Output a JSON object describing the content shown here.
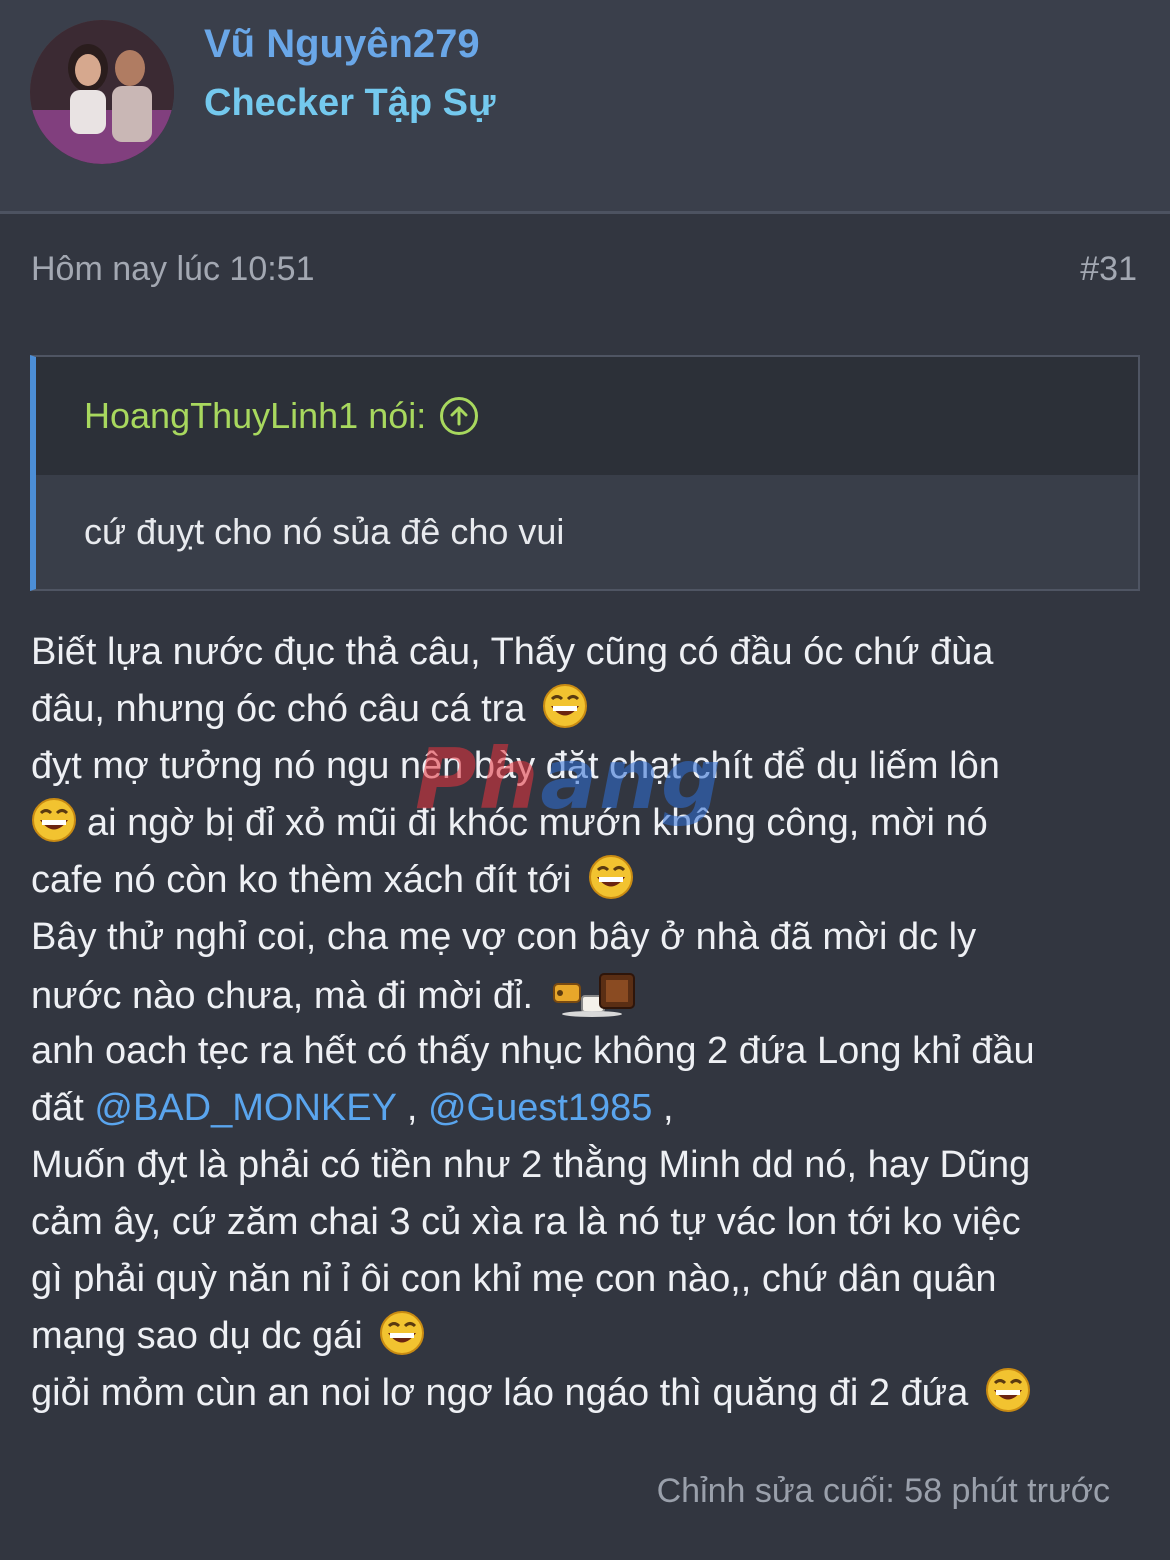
{
  "user": {
    "name": "Vũ Nguyên279",
    "title": "Checker Tập Sự"
  },
  "post": {
    "time": "Hôm nay lúc 10:51",
    "number": "#31",
    "edited": "Chỉnh sửa cuối: 58 phút trước"
  },
  "quote": {
    "author": "HoangThuyLinh1 nói:",
    "arrow_icon": "arrow-up-circle-icon",
    "text": "cứ đuỵt cho nó sủa đê cho vui"
  },
  "body": {
    "l1": "Biết lựa nước đục thả câu, Thấy cũng có đầu óc chứ đùa",
    "l2": "đâu, nhưng óc chó câu cá tra",
    "l3": "đỵt mợ tưởng nó ngu nên bày đặt chạt chít để dụ liếm lôn",
    "l4": "ai ngờ bị đỉ xỏ mũi đi khóc mướn không công, mời nó",
    "l5": "cafe nó còn ko thèm xách đít tới",
    "l6": "Bây thử nghỉ coi, cha mẹ vợ con bây ở nhà đã mời dc ly",
    "l7": "nước nào chưa, mà đi mời đỉ.",
    "l8": "anh oach tẹc ra hết có thấy nhục không 2 đứa Long khỉ đầu",
    "l9_prefix": "đất",
    "mention1": "@BAD_MONKEY",
    "sep1": ",",
    "mention2": "@Guest1985",
    "sep2": ",",
    "l10": "Muốn đỵt là phải có tiền như 2 thằng Minh dd nó, hay Dũng",
    "l11": "cảm ây, cứ zăm chai 3 củ xìa ra là nó tự vác lon tới ko việc",
    "l12": "gì phải quỳ năn nỉ ỉ ôi con khỉ mẹ con nào,, chứ dân quân",
    "l13": "mạng sao dụ dc gái",
    "l14": "giỏi mỏm cùn an noi lơ ngơ láo ngáo thì quăng đi 2 đứa"
  },
  "watermark": {
    "part1": "Ph",
    "part2": "ang"
  },
  "colors": {
    "background": "#323640",
    "header_bg": "#3a3f4b",
    "username": "#6aa7e8",
    "quote_author": "#a8d85e",
    "mention": "#5aa5ee",
    "quote_accent": "#4c8ed6"
  }
}
